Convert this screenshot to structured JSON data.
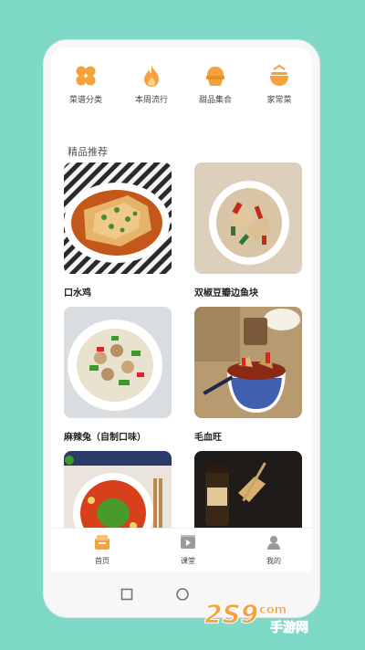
{
  "categories": [
    {
      "label": "菜谱分类",
      "icon": "grid-icon"
    },
    {
      "label": "本周流行",
      "icon": "flame-icon"
    },
    {
      "label": "甜品集合",
      "icon": "dessert-icon"
    },
    {
      "label": "家常菜",
      "icon": "bowl-icon"
    }
  ],
  "section_title": "精品推荐",
  "recipes": [
    {
      "name": "口水鸡"
    },
    {
      "name": "双椒豆瓣边鱼块"
    },
    {
      "name": "麻辣兔（自制口味）"
    },
    {
      "name": "毛血旺"
    },
    {
      "name": ""
    },
    {
      "name": ""
    }
  ],
  "tabs": [
    {
      "label": "首页",
      "icon": "home-icon"
    },
    {
      "label": "课堂",
      "icon": "video-icon"
    },
    {
      "label": "我的",
      "icon": "user-icon"
    }
  ],
  "watermark": {
    "number": "2S9",
    "suffix": "com",
    "text": "手游网"
  },
  "colors": {
    "accent": "#f5a23a",
    "background": "#7ed9c7"
  }
}
